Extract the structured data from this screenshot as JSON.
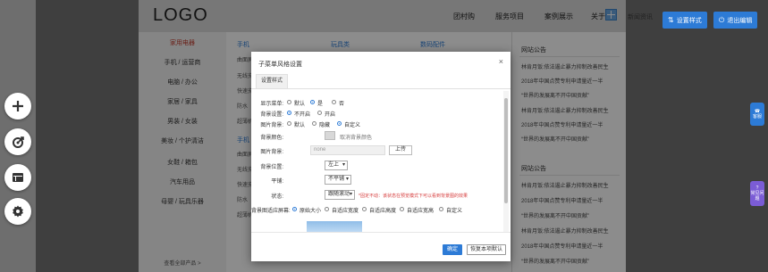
{
  "header": {
    "logo": "LOGO",
    "nav": [
      "团村购",
      "服务项目",
      "案例展示",
      "关于",
      "新闻资讯"
    ],
    "settings_btn": "设置样式",
    "exit_btn": "退出编辑"
  },
  "left_rail": [
    "add-icon",
    "target-icon",
    "layout-icon",
    "gear-icon"
  ],
  "categories": {
    "items": [
      "家用电器",
      "手机 / 运营商",
      "电脑 / 办公",
      "家居 / 家具",
      "男装 / 女装",
      "美妆 / 个护清洁",
      "女鞋 / 箱包",
      "汽车用品",
      "母婴 / 玩具乐器"
    ],
    "more": "查看全部产品 >"
  },
  "products": {
    "col_heads": [
      "手机",
      "玩具类",
      "数码配件"
    ],
    "lines_a": [
      "曲面屏",
      "无线充",
      "快速充",
      "防水",
      "超薄机"
    ],
    "col2_head": "手机",
    "lines_b": [
      "曲面屏",
      "无线充",
      "快速充",
      "防水",
      "超薄机"
    ]
  },
  "news": {
    "title1": "网站公告",
    "items1": [
      "林肯月饭:依法遏止暴力抑制改善民生",
      "2018年中国点赞专利申请量近一半",
      "“世界的发展离不开中国贡献”",
      "林肯月饭:依法遏止暴力抑制改善民生",
      "2018年中国点赞专利申请量近一半",
      "“世界的发展离不开中国贡献”"
    ],
    "title2": "网站公告",
    "items2": [
      "林肯月饭:依法遏止暴力抑制改善民生",
      "2018年中国点赞专利申请量近一半",
      "“世界的发展离不开中国贡献”",
      "林肯月饭:依法遏止暴力抑制改善民生",
      "2018年中国点赞专利申请量近一半",
      "“世界的发展离不开中国贡献”"
    ]
  },
  "side_tabs": {
    "tab1": "客服",
    "tab2": "常见问题"
  },
  "modal": {
    "title": "子菜单风格设置",
    "close": "×",
    "tab": "设置样式",
    "rows": {
      "show_submenu": {
        "label": "显示菜单:",
        "options": [
          "默认",
          "是",
          "否"
        ],
        "selected": 1
      },
      "bg_settings": {
        "label": "背景设置:",
        "options": [
          "不开启",
          "开启"
        ],
        "selected": 0
      },
      "bg_image": {
        "label": "图片背景:",
        "options": [
          "默认",
          "隐藏",
          "自定义"
        ],
        "selected": 2
      },
      "bg_color": {
        "label": "背景颜色:",
        "hint": "取消背景颜色"
      },
      "image": {
        "label": "图片背景:",
        "value": "none",
        "button": "上传"
      },
      "position": {
        "label": "背景位置:",
        "value": "左上"
      },
      "tile": {
        "label": "平铺:",
        "value": "不平铺"
      },
      "state": {
        "label": "状态:",
        "value": "跟随滚动",
        "warning": "*固定不动：该状态在预览模式下可以看到背景图的效果"
      },
      "size": {
        "label": "背景图适应屏幕:",
        "options": [
          "原始大小",
          "自适应宽度",
          "自适应高度",
          "自适应宽高",
          "自定义"
        ],
        "selected": 0
      }
    },
    "ok": "确定",
    "reset": "恢复本项默认"
  },
  "colors": {
    "accent": "#2d7bd6",
    "warning": "#d63c3c",
    "overlay": "#737373"
  }
}
